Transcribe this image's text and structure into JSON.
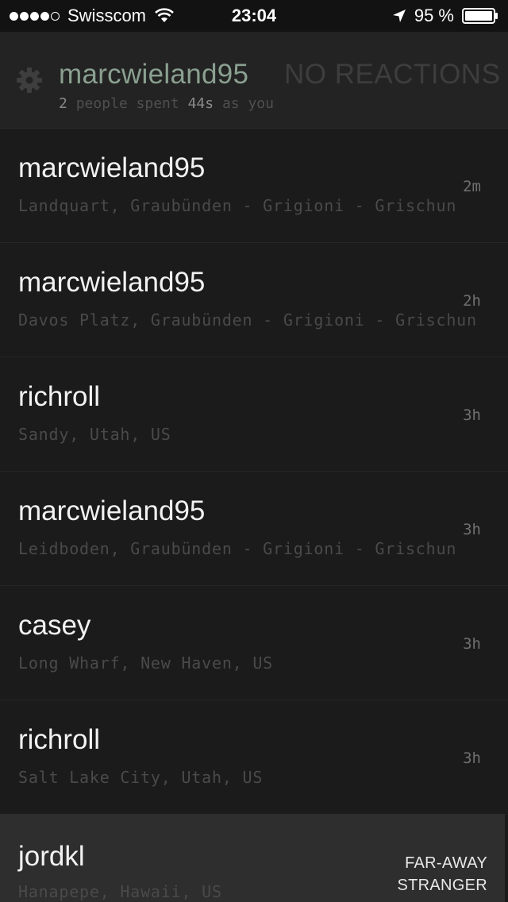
{
  "status_bar": {
    "carrier": "Swisscom",
    "time": "23:04",
    "battery": "95 %",
    "signal_dots_filled": 4,
    "signal_dots_total": 5
  },
  "header": {
    "username": "marcwieland95",
    "reactions": "NO REACTIONS",
    "sub_count": "2",
    "sub_text1": "people spent",
    "sub_duration": "44s",
    "sub_text2": "as you"
  },
  "list": [
    {
      "name": "marcwieland95",
      "location": "Landquart, Graubünden - Grigioni - Grischun",
      "time": "2m"
    },
    {
      "name": "marcwieland95",
      "location": "Davos Platz, Graubünden - Grigioni - Grischun",
      "time": "2h"
    },
    {
      "name": "richroll",
      "location": "Sandy, Utah, US",
      "time": "3h"
    },
    {
      "name": "marcwieland95",
      "location": "Leidboden, Graubünden - Grigioni - Grischun",
      "time": "3h"
    },
    {
      "name": "casey",
      "location": "Long Wharf, New Haven, US",
      "time": "3h"
    },
    {
      "name": "richroll",
      "location": "Salt Lake City, Utah, US",
      "time": "3h"
    }
  ],
  "last_row": {
    "name": "jordkl",
    "location": "Hanapepe, Hawaii, US",
    "tag_line1": "FAR-AWAY",
    "tag_line2": "STRANGER"
  },
  "colors": {
    "background": "#1a1a1a",
    "accent_username": "#8aa090",
    "highlight_row": "#2e2e2e"
  }
}
